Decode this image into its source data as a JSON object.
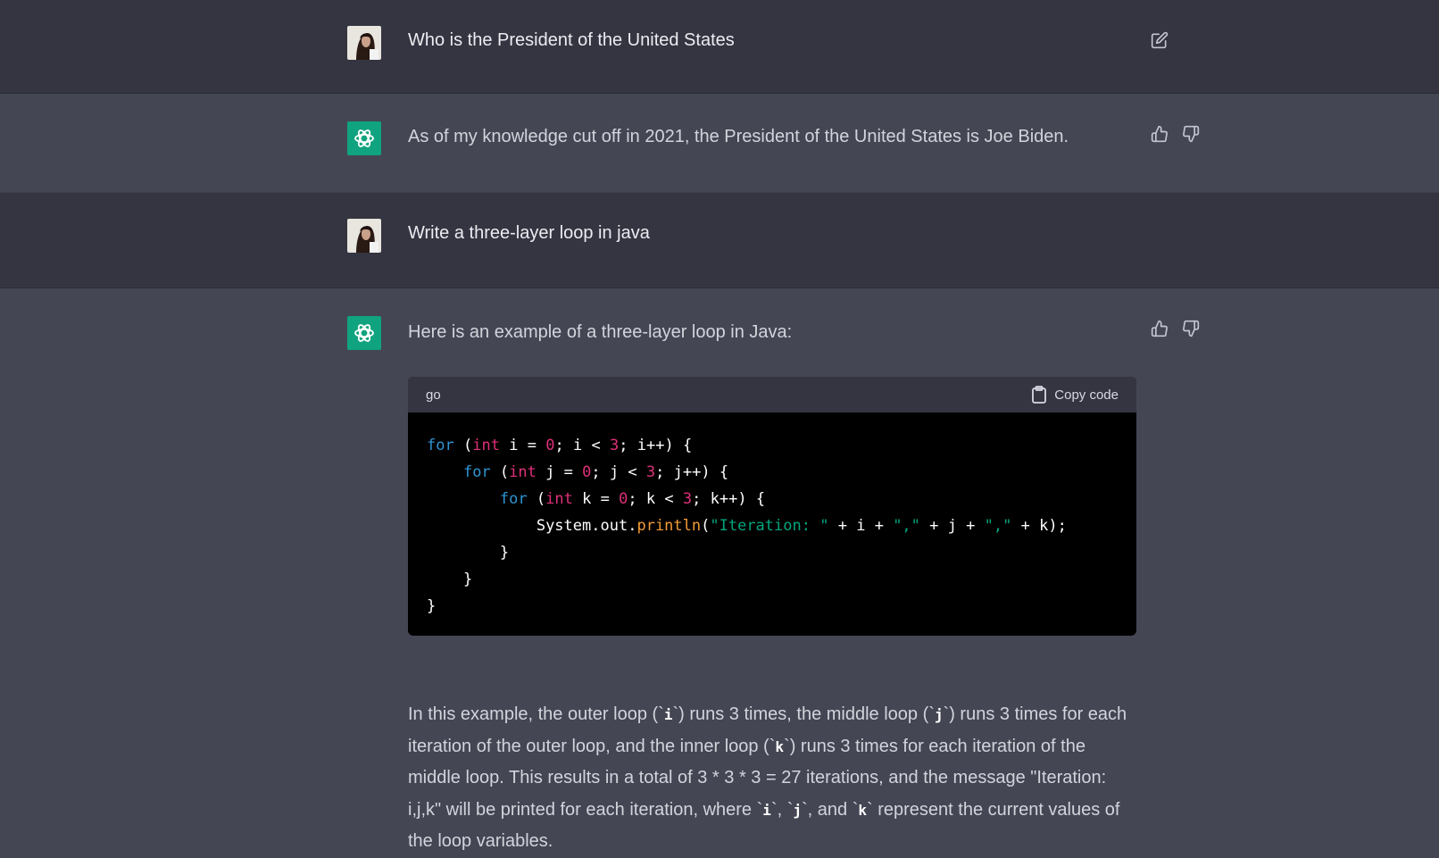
{
  "conversation": {
    "m1": {
      "role": "user",
      "text": "Who is the President of the United States"
    },
    "m2": {
      "role": "assistant",
      "text": "As of my knowledge cut off in 2021, the President of the United States is Joe Biden."
    },
    "m3": {
      "role": "user",
      "text": "Write a three-layer loop in java"
    },
    "m4": {
      "role": "assistant",
      "intro": "Here is an example of a three-layer loop in Java:",
      "code": {
        "language": "go",
        "copy_label": "Copy code",
        "lines": [
          "for (int i = 0; i < 3; i++) {",
          "    for (int j = 0; j < 3; j++) {",
          "        for (int k = 0; k < 3; k++) {",
          "            System.out.println(\"Iteration: \" + i + \",\" + j + \",\" + k);",
          "        }",
          "    }",
          "}"
        ]
      },
      "explanation": {
        "p1": "In this example, the outer loop (`",
        "c1": "i",
        "p2": "`) runs 3 times, the middle loop (`",
        "c2": "j",
        "p3": "`) runs 3 times for each iteration of the outer loop, and the inner loop (`",
        "c3": "k",
        "p4": "`) runs 3 times for each iteration of the middle loop. This results in a total of 3 * 3 * 3 = 27 iterations, and the message \"Iteration: i,j,k\" will be printed for each iteration, where `",
        "c4": "i",
        "p5": "`, `",
        "c5": "j",
        "p6": "`, and `",
        "c6": "k",
        "p7": "` represent the current values of the loop variables."
      }
    }
  },
  "icons": {
    "edit": "edit-icon",
    "thumbs_up": "thumbs-up-icon",
    "thumbs_down": "thumbs-down-icon",
    "copy": "clipboard-icon",
    "assistant_logo": "openai-logo-icon",
    "user_avatar": "user-avatar"
  },
  "colors": {
    "user_bg": "#343541",
    "assistant_bg": "#444654",
    "accent": "#10a37f",
    "code_bg": "#000000",
    "keyword": "#2e95d3",
    "type": "#df3079",
    "string": "#00a67d",
    "function": "#f29b35"
  }
}
